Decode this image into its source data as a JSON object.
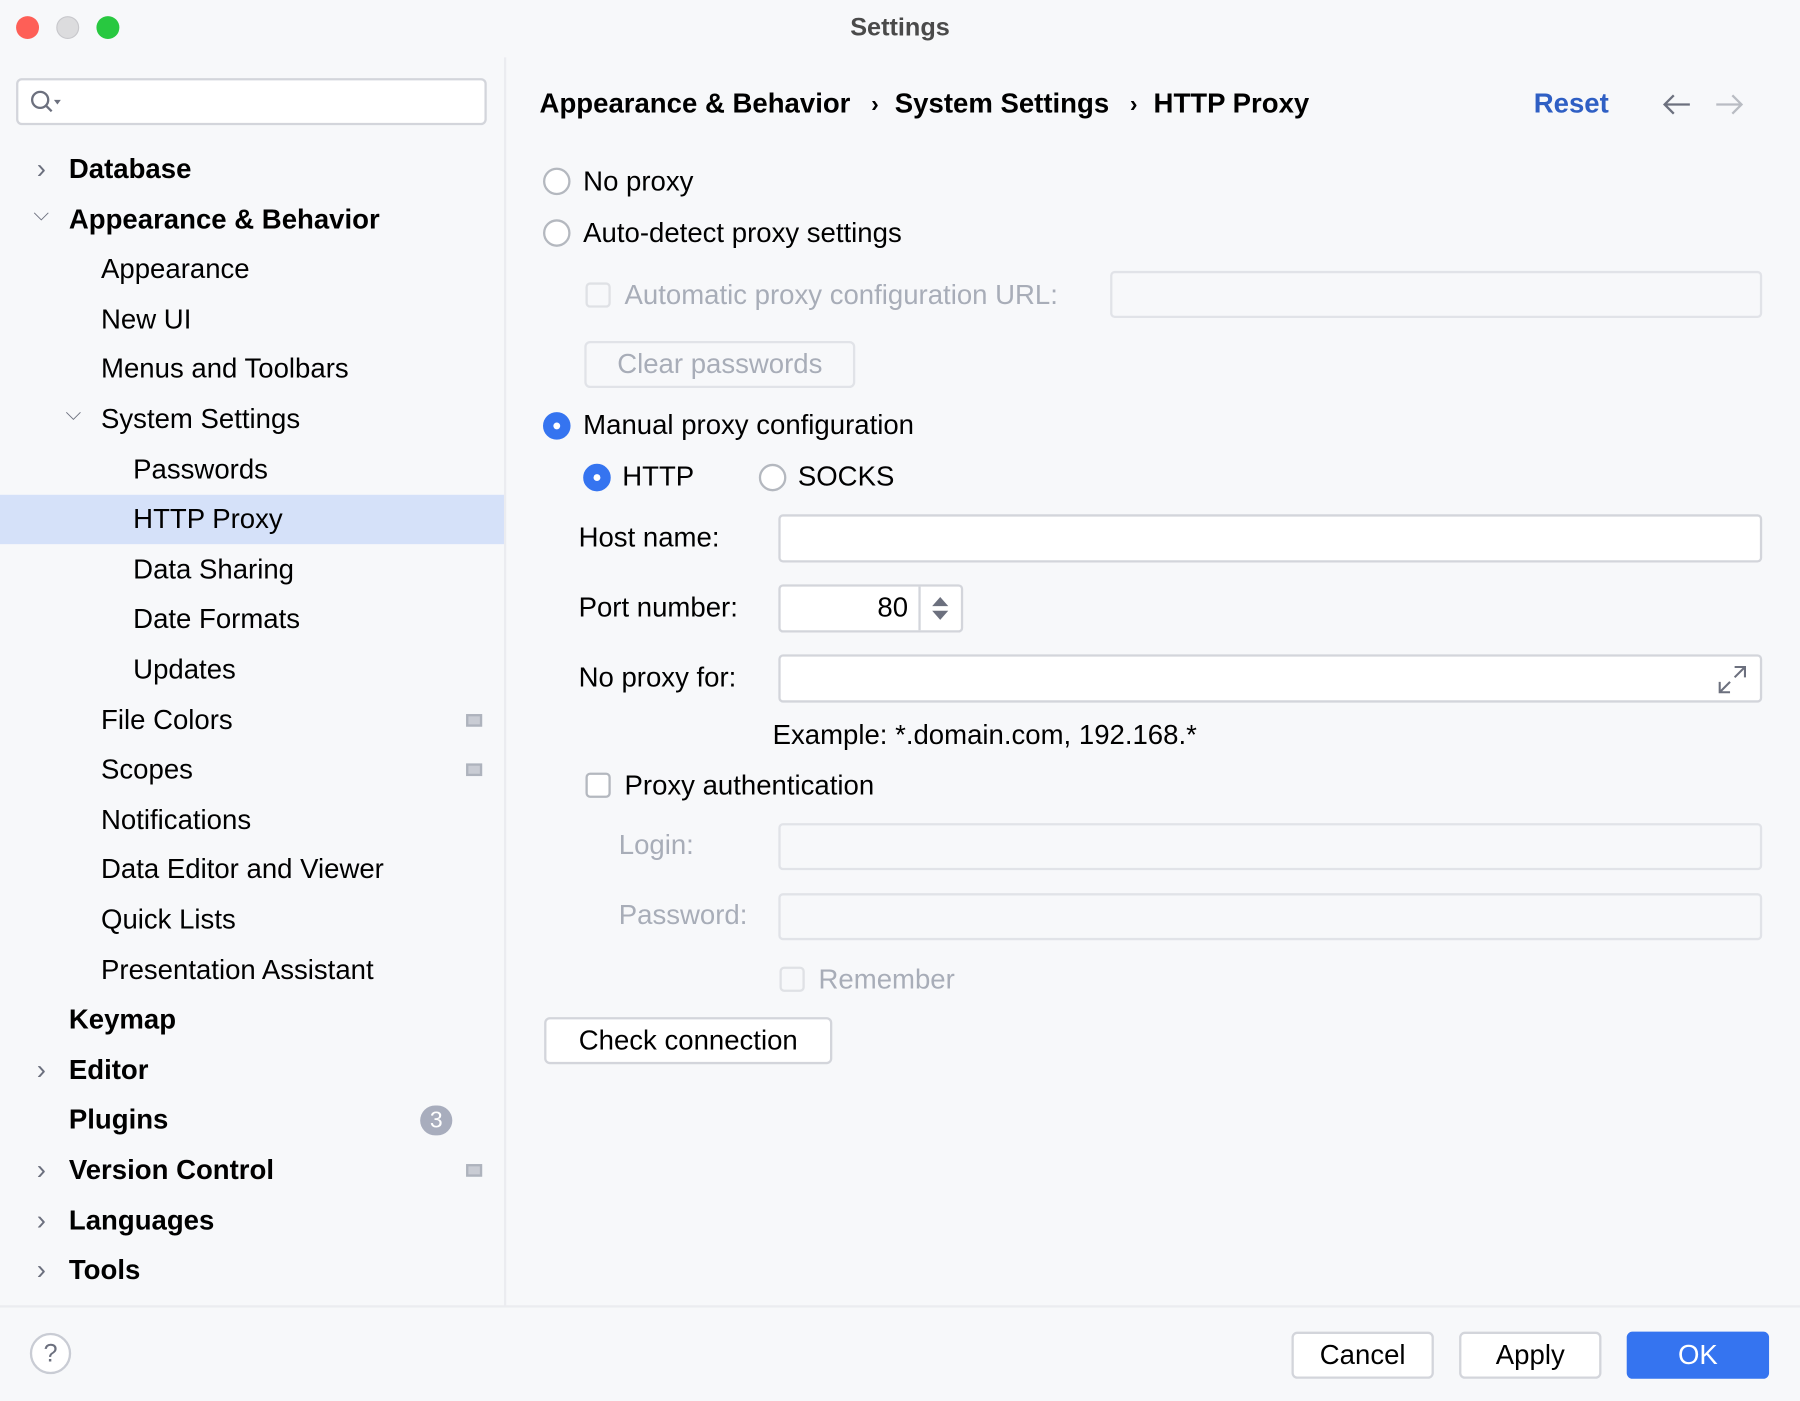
{
  "window": {
    "title": "Settings"
  },
  "search": {
    "placeholder": "",
    "value": ""
  },
  "sidebar": {
    "items": [
      {
        "label": "Database",
        "level": 0,
        "bold": true,
        "chevron": "right"
      },
      {
        "label": "Appearance & Behavior",
        "level": 0,
        "bold": true,
        "chevron": "down"
      },
      {
        "label": "Appearance",
        "level": 1
      },
      {
        "label": "New UI",
        "level": 1
      },
      {
        "label": "Menus and Toolbars",
        "level": 1
      },
      {
        "label": "System Settings",
        "level": 1,
        "chevron": "down"
      },
      {
        "label": "Passwords",
        "level": 2
      },
      {
        "label": "HTTP Proxy",
        "level": 2,
        "selected": true
      },
      {
        "label": "Data Sharing",
        "level": 2
      },
      {
        "label": "Date Formats",
        "level": 2
      },
      {
        "label": "Updates",
        "level": 2
      },
      {
        "label": "File Colors",
        "level": 1,
        "icon": "project-level-icon"
      },
      {
        "label": "Scopes",
        "level": 1,
        "icon": "project-level-icon"
      },
      {
        "label": "Notifications",
        "level": 1
      },
      {
        "label": "Data Editor and Viewer",
        "level": 1
      },
      {
        "label": "Quick Lists",
        "level": 1
      },
      {
        "label": "Presentation Assistant",
        "level": 1
      },
      {
        "label": "Keymap",
        "level": 0,
        "bold": true
      },
      {
        "label": "Editor",
        "level": 0,
        "bold": true,
        "chevron": "right"
      },
      {
        "label": "Plugins",
        "level": 0,
        "bold": true,
        "badge": "3"
      },
      {
        "label": "Version Control",
        "level": 0,
        "bold": true,
        "chevron": "right",
        "icon": "project-level-icon"
      },
      {
        "label": "Languages",
        "level": 0,
        "bold": true,
        "chevron": "right"
      },
      {
        "label": "Tools",
        "level": 0,
        "bold": true,
        "chevron": "right"
      }
    ]
  },
  "breadcrumb": [
    "Appearance & Behavior",
    "System Settings",
    "HTTP Proxy"
  ],
  "header": {
    "reset": "Reset",
    "back_icon": "arrow-left-icon",
    "forward_icon": "arrow-right-icon"
  },
  "proxy": {
    "no_proxy": "No proxy",
    "auto_detect": "Auto-detect proxy settings",
    "auto_url_label": "Automatic proxy configuration URL:",
    "auto_url_value": "",
    "clear_passwords": "Clear passwords",
    "manual": "Manual proxy configuration",
    "selected_mode": "manual",
    "http": "HTTP",
    "socks": "SOCKS",
    "selected_type": "HTTP",
    "host_label": "Host name:",
    "host_value": "",
    "port_label": "Port number:",
    "port_value": "80",
    "no_proxy_for_label": "No proxy for:",
    "no_proxy_for_value": "",
    "example": "Example: *.domain.com, 192.168.*",
    "auth_label": "Proxy authentication",
    "auth_checked": false,
    "login_label": "Login:",
    "login_value": "",
    "password_label": "Password:",
    "password_value": "",
    "remember": "Remember",
    "check_connection": "Check connection"
  },
  "footer": {
    "help": "?",
    "cancel": "Cancel",
    "apply": "Apply",
    "ok": "OK"
  },
  "colors": {
    "accent": "#3574f0",
    "link": "#2f5fc4",
    "selection": "#d5e1f9",
    "background": "#f7f8fa"
  }
}
